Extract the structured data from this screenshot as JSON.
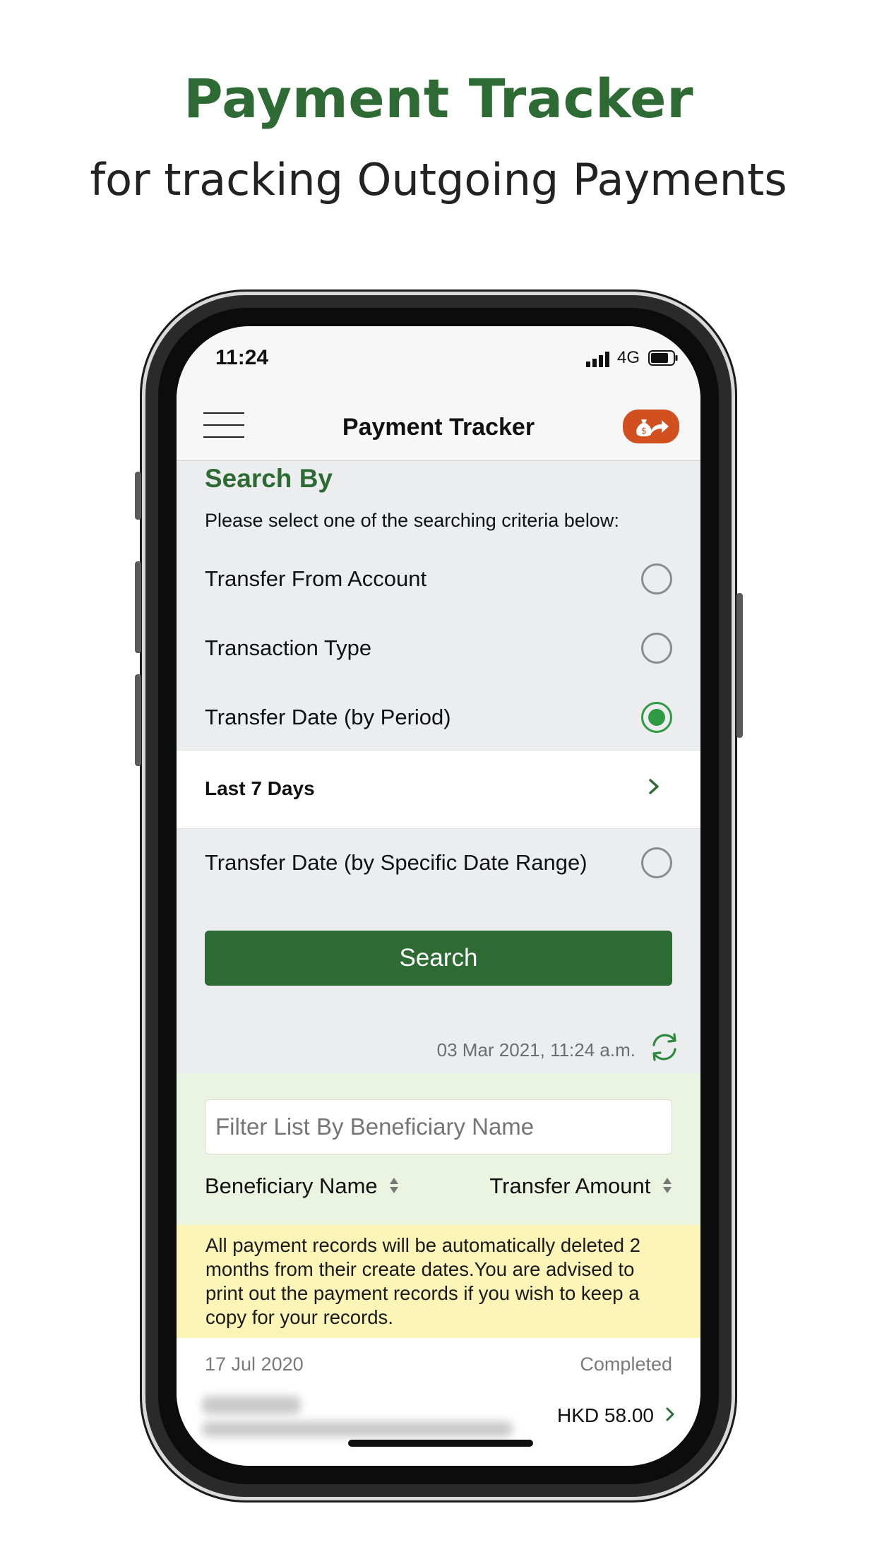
{
  "hero": {
    "title": "Payment Tracker",
    "subtitle": "for tracking Outgoing Payments"
  },
  "status_bar": {
    "time": "11:24",
    "network": "4G"
  },
  "nav": {
    "title": "Payment Tracker",
    "menu_icon": "hamburger-menu-icon",
    "action_icon": "money-bag-transfer-icon"
  },
  "search": {
    "section_title": "Search By",
    "instruction": "Please select one of the searching criteria below:",
    "options": [
      {
        "label": "Transfer From Account",
        "selected": false
      },
      {
        "label": "Transaction Type",
        "selected": false
      },
      {
        "label": "Transfer Date (by Period)",
        "selected": true
      },
      {
        "label": "Transfer Date (by Specific Date Range)",
        "selected": false
      }
    ],
    "period_value": "Last 7 Days",
    "button_label": "Search",
    "timestamp": "03 Mar 2021, 11:24 a.m."
  },
  "filter": {
    "placeholder": "Filter List By Beneficiary Name",
    "columns": [
      "Beneficiary Name",
      "Transfer Amount"
    ]
  },
  "notice": "All payment records will be automatically deleted 2 months from their create dates.You are advised to print out the payment records if you wish to keep a copy for your records.",
  "records": [
    {
      "date": "17 Jul 2020",
      "status": "Completed",
      "amount": "HKD 58.00"
    }
  ],
  "colors": {
    "brand_green": "#2e6b34",
    "radio_green": "#2f9a44",
    "accent_orange": "#d24f1f",
    "notice_yellow": "#fdf5b8",
    "filter_green": "#eaf4e1"
  }
}
